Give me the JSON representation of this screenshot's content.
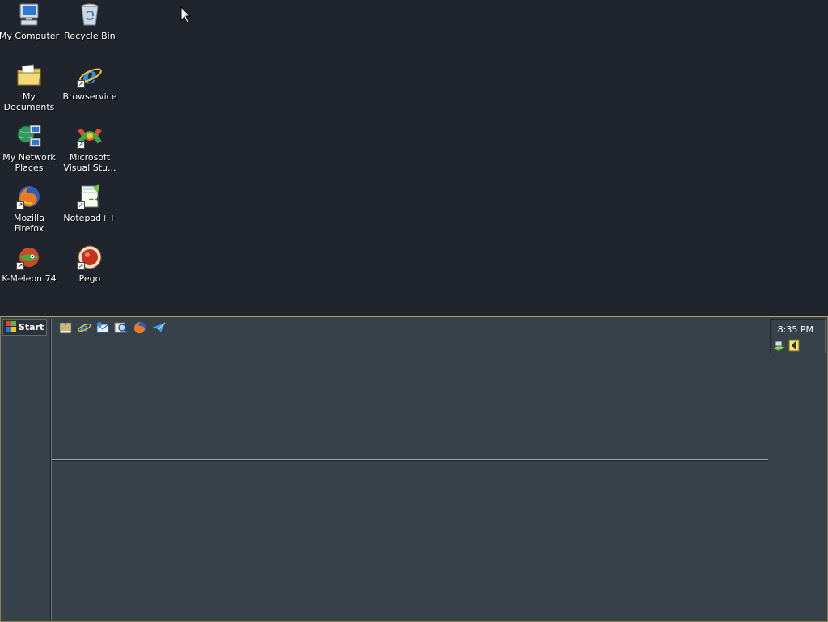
{
  "desktop": {
    "icons": [
      {
        "name": "my-computer",
        "label": "My Computer"
      },
      {
        "name": "recycle-bin",
        "label": "Recycle Bin"
      },
      {
        "name": "my-documents",
        "label": "My Documents"
      },
      {
        "name": "browservice",
        "label": "Browservice"
      },
      {
        "name": "my-network-places",
        "label": "My Network\nPlaces"
      },
      {
        "name": "microsoft-visual-studio",
        "label": "Microsoft\nVisual Stu..."
      },
      {
        "name": "mozilla-firefox",
        "label": "Mozilla Firefox"
      },
      {
        "name": "notepad-plus-plus",
        "label": "Notepad++"
      },
      {
        "name": "k-meleon",
        "label": "K-Meleon 74"
      },
      {
        "name": "pego",
        "label": "Pego"
      }
    ]
  },
  "taskbar": {
    "start_label": "Start",
    "quick_launch": [
      {
        "icon": "show-desktop-icon"
      },
      {
        "icon": "internet-explorer-icon"
      },
      {
        "icon": "outlook-express-icon"
      },
      {
        "icon": "search-icon"
      },
      {
        "icon": "firefox-icon"
      },
      {
        "icon": "messenger-icon"
      }
    ],
    "tray": {
      "clock": "8:35 PM",
      "icons": [
        "network-icon",
        "volume-icon"
      ]
    }
  },
  "colors": {
    "desktop_bg": "#1f242d",
    "taskbar_bg": "#37414a",
    "taskbar_border": "#b5a35a"
  }
}
